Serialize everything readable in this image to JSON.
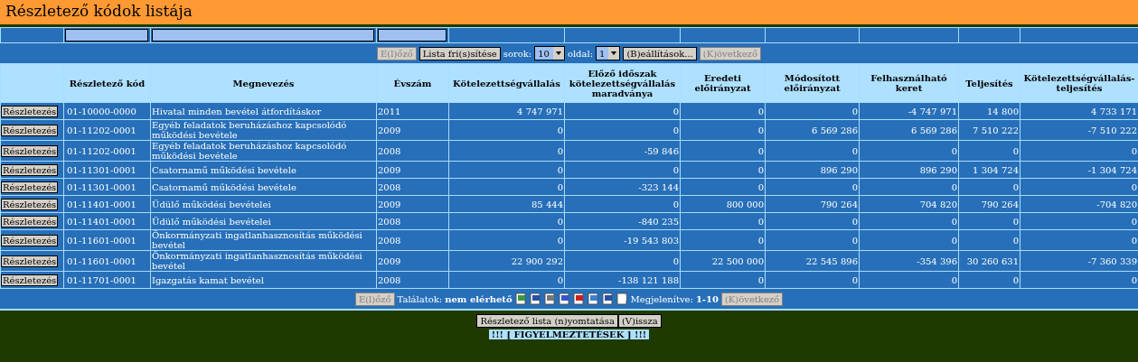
{
  "title": "Részletező kódok listája",
  "toolbar": {
    "prev": "E(l)őző",
    "refresh": "Lista fri(s)sítése",
    "rows_label": "sorok:",
    "rows_value": "10",
    "page_label": "oldal:",
    "page_value": "1",
    "settings": "(B)eállítások...",
    "next": "(K)övetkező",
    "prev_disabled": true,
    "next_disabled": true
  },
  "columns": [
    "",
    "Részletező kód",
    "Megnevezés",
    "Évszám",
    "Kötelezettségvállalás",
    "Előző időszak kötelezettségvállalás maradványa",
    "Eredeti előirányzat",
    "Módosított előirányzat",
    "Felhasználható keret",
    "Teljesítés",
    "Kötelezettségvállalás-teljesítés"
  ],
  "rows": [
    {
      "action": "Részletezés",
      "cells": [
        "01-10000-0000",
        "Hivatal minden bevétel átfordításkor",
        "2011",
        "4 747 971",
        "0",
        "0",
        "0",
        "-4 747 971",
        "14 800",
        "4 733 171"
      ]
    },
    {
      "action": "Részletezés",
      "cells": [
        "01-11202-0001",
        "Egyéb feladatok beruházáshoz kapcsolódó működési bevétele",
        "2009",
        "0",
        "0",
        "0",
        "6 569 286",
        "6 569 286",
        "7 510 222",
        "-7 510 222"
      ]
    },
    {
      "action": "Részletezés",
      "cells": [
        "01-11202-0001",
        "Egyéb feladatok beruházáshoz kapcsolódó működési bevétele",
        "2008",
        "0",
        "-59 846",
        "0",
        "0",
        "0",
        "0",
        "0"
      ]
    },
    {
      "action": "Részletezés",
      "cells": [
        "01-11301-0001",
        "Csatornamű működési bevétele",
        "2009",
        "0",
        "0",
        "0",
        "896 290",
        "896 290",
        "1 304 724",
        "-1 304 724"
      ]
    },
    {
      "action": "Részletezés",
      "cells": [
        "01-11301-0001",
        "Csatornamű működési bevétele",
        "2008",
        "0",
        "-323 144",
        "0",
        "0",
        "0",
        "0",
        "0"
      ]
    },
    {
      "action": "Részletezés",
      "cells": [
        "01-11401-0001",
        "Üdülő működési bevételei",
        "2009",
        "85 444",
        "0",
        "800 000",
        "790 264",
        "704 820",
        "790 264",
        "-704 820"
      ]
    },
    {
      "action": "Részletezés",
      "cells": [
        "01-11401-0001",
        "Üdülő működési bevételei",
        "2008",
        "0",
        "-840 235",
        "0",
        "0",
        "0",
        "0",
        "0"
      ]
    },
    {
      "action": "Részletezés",
      "cells": [
        "01-11601-0001",
        "Önkormányzati ingatlanhasznosítás működési bevétel",
        "2008",
        "0",
        "-19 543 803",
        "0",
        "0",
        "0",
        "0",
        "0"
      ]
    },
    {
      "action": "Részletezés",
      "cells": [
        "01-11601-0001",
        "Önkormányzati ingatlanhasznosítás működési bevétel",
        "2009",
        "22 900 292",
        "0",
        "22 500 000",
        "22 545 896",
        "-354 396",
        "30 260 631",
        "-7 360 339"
      ]
    },
    {
      "action": "Részletezés",
      "cells": [
        "01-11701-0001",
        "Igazgatás kamat bevétel",
        "2008",
        "0",
        "-138 121 188",
        "0",
        "0",
        "0",
        "0",
        "0"
      ]
    }
  ],
  "footer": {
    "prev": "E(l)őző",
    "results_label": "Találatok:",
    "results_value": "nem elérhető",
    "shown_label": "Megjelenítve:",
    "shown_value": "1-10",
    "next": "(K)övetkező",
    "prev_disabled": true,
    "next_disabled": true
  },
  "actions": [
    "Részletező lista (n)yomtatása",
    "(V)issza"
  ],
  "warning": "!!! [ FIGYELMEZTETÉSEK ] !!!"
}
